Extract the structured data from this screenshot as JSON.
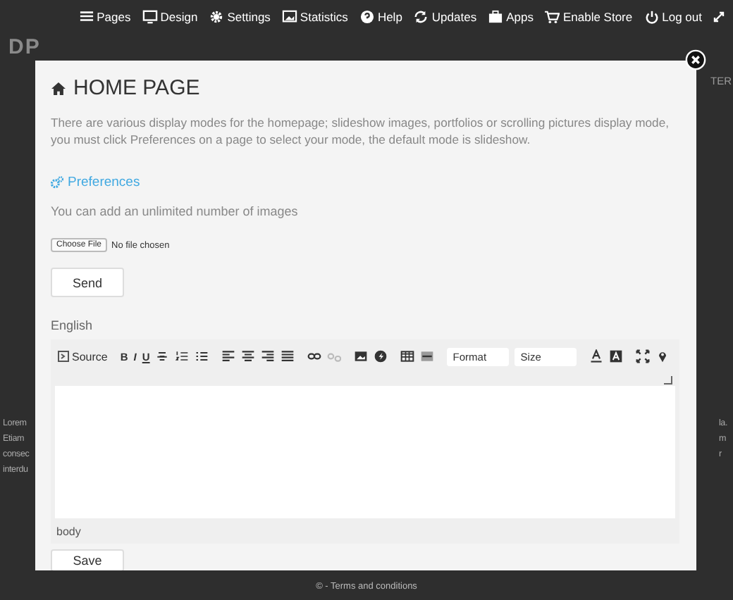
{
  "nav": [
    {
      "label": "Pages"
    },
    {
      "label": "Design"
    },
    {
      "label": "Settings"
    },
    {
      "label": "Statistics"
    },
    {
      "label": "Help"
    },
    {
      "label": "Updates"
    },
    {
      "label": "Apps"
    },
    {
      "label": "Enable Store"
    },
    {
      "label": "Log out"
    }
  ],
  "site_title": "DP",
  "header_right": "TER",
  "background_text": {
    "left": [
      "Lorem",
      "Etiam",
      "consec",
      "interdu"
    ],
    "right": [
      "la.",
      "m",
      "r"
    ]
  },
  "footer": "© - Terms and conditions",
  "modal": {
    "title": "HOME PAGE",
    "description": "There are various display modes for the homepage; slideshow images, portfolios or scrolling pictures display mode, you must click Preferences on a page to select your mode, the default mode is slideshow.",
    "preferences_link": "Preferences",
    "images_note": "You can add an unlimited number of images",
    "file_input": {
      "button": "Choose File",
      "status": "No file chosen"
    },
    "send_button": "Send",
    "language_label": "English",
    "editor": {
      "toolbar": [
        [
          {
            "kind": "labeled",
            "label": "Source"
          }
        ],
        [
          {
            "kind": "char",
            "label": "B"
          },
          {
            "kind": "char",
            "label": "I"
          },
          {
            "kind": "char",
            "label": "U"
          },
          {
            "kind": "icon"
          },
          {
            "kind": "icon"
          },
          {
            "kind": "icon"
          }
        ],
        [
          {
            "kind": "icon"
          },
          {
            "kind": "icon"
          },
          {
            "kind": "icon"
          },
          {
            "kind": "icon"
          }
        ],
        [
          {
            "kind": "icon",
            "disabled": false
          },
          {
            "kind": "icon",
            "disabled": true
          }
        ],
        [
          {
            "kind": "icon"
          },
          {
            "kind": "icon"
          }
        ],
        [
          {
            "kind": "icon"
          },
          {
            "kind": "icon"
          }
        ],
        [
          {
            "kind": "select",
            "label": "Format"
          },
          {
            "kind": "select",
            "label": "Size"
          }
        ],
        [
          {
            "kind": "icon"
          },
          {
            "kind": "icon"
          }
        ],
        [
          {
            "kind": "icon"
          },
          {
            "kind": "icon"
          }
        ]
      ],
      "path": "body"
    },
    "save_button": "Save"
  }
}
